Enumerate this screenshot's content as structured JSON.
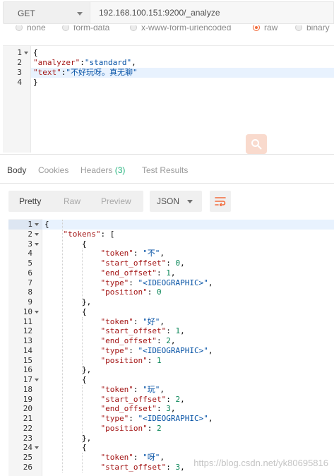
{
  "request": {
    "method": "GET",
    "url": "192.168.100.151:9200/_analyze"
  },
  "body_types": [
    {
      "label": "none",
      "checked": false
    },
    {
      "label": "form-data",
      "checked": false
    },
    {
      "label": "x-www-form-urlencoded",
      "checked": false
    },
    {
      "label": "raw",
      "checked": true
    },
    {
      "label": "binary",
      "checked": false
    }
  ],
  "request_body": {
    "line_numbers": [
      "1",
      "2",
      "3",
      "4"
    ],
    "lines": [
      "{",
      "\"analyzer\":\"standard\",",
      "\"text\":\"不好玩呀。真无聊\"",
      "}"
    ],
    "active_line": 3
  },
  "response_tabs": {
    "body": "Body",
    "cookies": "Cookies",
    "headers": "Headers",
    "headers_count": "(3)",
    "test_results": "Test Results"
  },
  "toolbar": {
    "pretty": "Pretty",
    "raw": "Raw",
    "preview": "Preview",
    "format": "JSON"
  },
  "response_body": {
    "line_numbers": [
      "1",
      "2",
      "3",
      "4",
      "5",
      "6",
      "7",
      "8",
      "9",
      "10",
      "11",
      "12",
      "13",
      "14",
      "15",
      "16",
      "17",
      "18",
      "19",
      "20",
      "21",
      "22",
      "23",
      "24",
      "25",
      "26"
    ],
    "fold_lines": [
      1,
      2,
      3,
      10,
      17,
      24
    ],
    "lines": [
      "{",
      "    \"tokens\": [",
      "        {",
      "            \"token\": \"不\",",
      "            \"start_offset\": 0,",
      "            \"end_offset\": 1,",
      "            \"type\": \"<IDEOGRAPHIC>\",",
      "            \"position\": 0",
      "        },",
      "        {",
      "            \"token\": \"好\",",
      "            \"start_offset\": 1,",
      "            \"end_offset\": 2,",
      "            \"type\": \"<IDEOGRAPHIC>\",",
      "            \"position\": 1",
      "        },",
      "        {",
      "            \"token\": \"玩\",",
      "            \"start_offset\": 2,",
      "            \"end_offset\": 3,",
      "            \"type\": \"<IDEOGRAPHIC>\",",
      "            \"position\": 2",
      "        },",
      "        {",
      "            \"token\": \"呀\",",
      "            \"start_offset\": 3,"
    ]
  },
  "watermark": "https://blog.csdn.net/yk80695816",
  "colors": {
    "accent": "#f26b3a",
    "badge": "#26b47f",
    "json_key": "#a31515",
    "json_string": "#0451a5",
    "json_number": "#098658"
  }
}
